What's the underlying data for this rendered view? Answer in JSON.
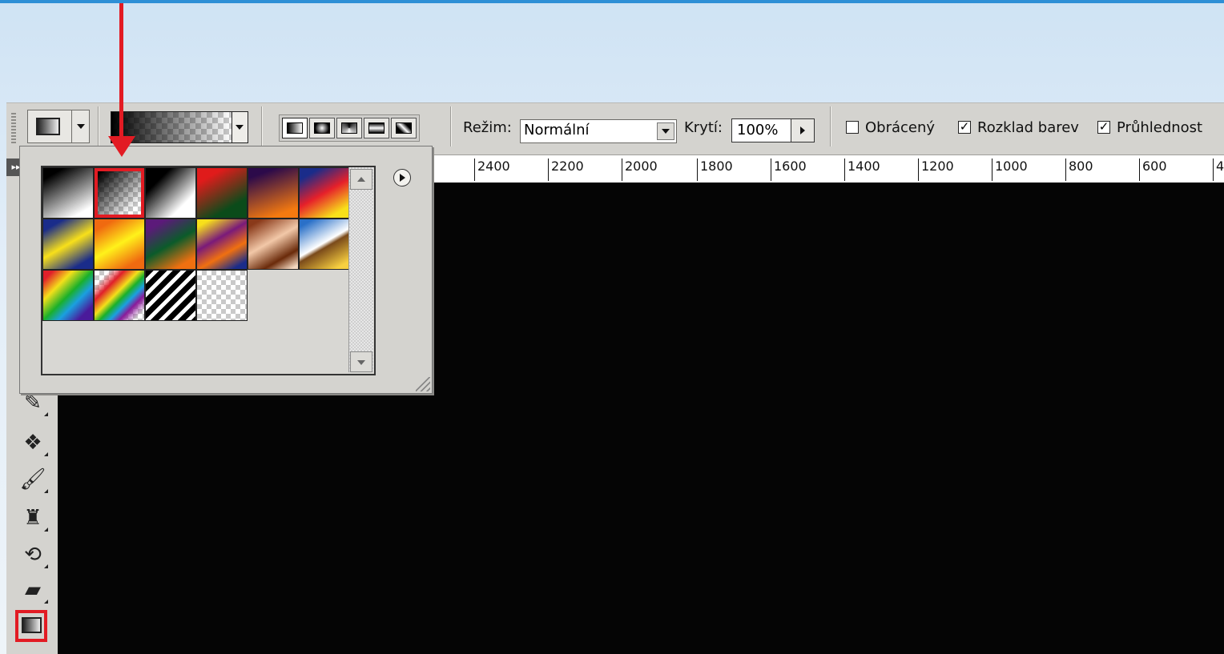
{
  "options_bar": {
    "mode_label": "Režim:",
    "mode_value": "Normální",
    "opacity_label": "Krytí:",
    "opacity_value": "100%",
    "reverse_label": "Obrácený",
    "reverse_checked": false,
    "dither_label": "Rozklad barev",
    "dither_checked": true,
    "transparency_label": "Průhlednost",
    "transparency_checked": true
  },
  "ruler": {
    "labels": [
      "2400",
      "2200",
      "2000",
      "1800",
      "1600",
      "1400",
      "1200",
      "1000",
      "800",
      "600",
      "4"
    ]
  },
  "gradient_presets": [
    {
      "name": "black-white"
    },
    {
      "name": "foreground-transparent",
      "selected": true
    },
    {
      "name": "black-white-angle"
    },
    {
      "name": "red-green"
    },
    {
      "name": "violet-orange"
    },
    {
      "name": "blue-red-yellow"
    },
    {
      "name": "blue-yellow-blue"
    },
    {
      "name": "orange-yellow-orange"
    },
    {
      "name": "violet-green-orange"
    },
    {
      "name": "yellow-violet-orange-blue"
    },
    {
      "name": "copper"
    },
    {
      "name": "chrome"
    },
    {
      "name": "spectrum"
    },
    {
      "name": "transparent-rainbow"
    },
    {
      "name": "transparent-stripes"
    },
    {
      "name": "transparent"
    }
  ],
  "colors": {
    "highlight": "#e21b23",
    "canvas": "#050505",
    "panel": "#d4d3cf"
  },
  "icons": {
    "tools": [
      "eyedropper-icon",
      "patch-icon",
      "brush-icon",
      "stamp-icon",
      "history-brush-icon",
      "eraser-icon",
      "gradient-icon"
    ]
  }
}
